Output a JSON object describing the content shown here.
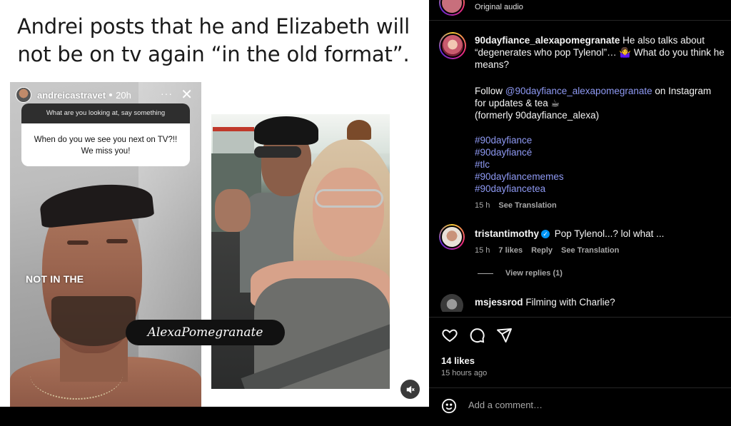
{
  "post_image": {
    "headline": "Andrei posts that he and Elizabeth will not be on tv again “in the old format”.",
    "story": {
      "username": "andreicastravet",
      "time": "20h",
      "more": "···",
      "close": "✕",
      "question_prompt": "What are you looking at, say something",
      "question_answer": "When do you we see you next on TV?!! We miss you!",
      "overlay_text": "NOT IN THE"
    },
    "watermark": "AlexaPomegranate"
  },
  "comments_panel": {
    "audio_label": "Original audio",
    "caption": {
      "username": "90dayfiance_alexapomegranate",
      "text": "He also talks about “degenerates who pop Tylenol”… 🤷‍♀️ What do you think he means?",
      "follow_prefix": "Follow ",
      "follow_mention": "@90dayfiance_alexapomegranate",
      "follow_suffix": " on Instagram for updates & tea ☕",
      "formerly": "(formerly 90dayfiance_alexa)",
      "hashtags": [
        "#90dayfiance",
        "#90dayfiancé",
        "#tlc",
        "#90dayfiancememes",
        "#90dayfiancetea"
      ],
      "time": "15 h",
      "see_translation": "See Translation"
    },
    "comments": [
      {
        "username": "tristantimothy",
        "verified_glyph": "✓",
        "text": "Pop Tylenol...? lol what ...",
        "time": "15 h",
        "likes": "7 likes",
        "reply": "Reply",
        "see_translation": "See Translation",
        "view_replies": "View replies (1)"
      },
      {
        "username": "msjessrod",
        "text": "Filming with Charlie?"
      }
    ],
    "likes_count": "14 likes",
    "posted_ago": "15 hours ago",
    "comment_placeholder": "Add a comment…",
    "colors": {
      "link": "#8e99f3",
      "verified": "#0095f6",
      "muted_text": "#a8a8a8"
    }
  }
}
